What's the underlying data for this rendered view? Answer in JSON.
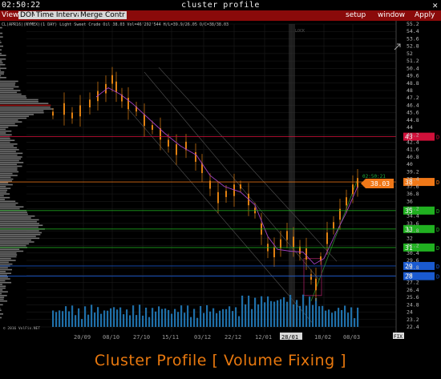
{
  "window": {
    "clock": "02:50:22",
    "title": "cluster profile",
    "close_glyph": "✕"
  },
  "menu": {
    "view": "View",
    "dom": "DOM",
    "time_interval": "Time Interval",
    "merge": "Merge Contr",
    "setup": "setup",
    "window": "window",
    "apply": "Apply"
  },
  "chart": {
    "header": "CL(APR16)(NYMEX)(1 DAY) Light Sweet Crude Oil 38.03 Vol=46'292'544 H/L=39.9/26.05 O/C=38/38.03",
    "watermark": "© 2016 VolFix.NET",
    "top_marker": "LOCK",
    "current_time": "02:50:21",
    "current_price": "38.03",
    "fix_label": "FIX",
    "price_ticks": [
      "55.2",
      "54.4",
      "53.6",
      "52.8",
      "52",
      "51.2",
      "50.4",
      "49.6",
      "48.8",
      "48",
      "47.2",
      "46.4",
      "45.6",
      "44.8",
      "44",
      "43.2",
      "42.4",
      "41.6",
      "40.8",
      "40",
      "39.2",
      "38.4",
      "37.6",
      "36.8",
      "36",
      "35.2",
      "34.4",
      "33.6",
      "32.8",
      "32",
      "31.2",
      "30.4",
      "29.6",
      "28.8",
      "28",
      "27.2",
      "26.4",
      "25.6",
      "24.8",
      "24",
      "23.2",
      "22.4"
    ],
    "date_ticks": [
      "20/09",
      "08/10",
      "27/10",
      "15/11",
      "03/12",
      "22/12",
      "12/01",
      "28/01",
      "18/02",
      "08/03"
    ],
    "levels": [
      {
        "label": "43",
        "color": "#d0103a",
        "type": "red"
      },
      {
        "label": "38",
        "color": "#f07818",
        "type": "orange"
      },
      {
        "label": "35",
        "color": "#20b020",
        "type": "green"
      },
      {
        "label": "33",
        "color": "#20b020",
        "type": "green"
      },
      {
        "label": "31",
        "color": "#20b020",
        "type": "green"
      },
      {
        "label": "29",
        "color": "#1a5ad0",
        "type": "blue"
      },
      {
        "label": "28",
        "color": "#1a5ad0",
        "type": "blue"
      }
    ],
    "level_flag": "D",
    "colors": {
      "bg": "#000",
      "grid": "#1f1f1f",
      "candle": "#e08010",
      "ma": "#a040c0",
      "volume": "#1f6fa8",
      "profile": "#9a9a9a",
      "profile_poc": "#d01818"
    }
  },
  "caption": "Cluster Profile [ Volume Fixing ]"
}
